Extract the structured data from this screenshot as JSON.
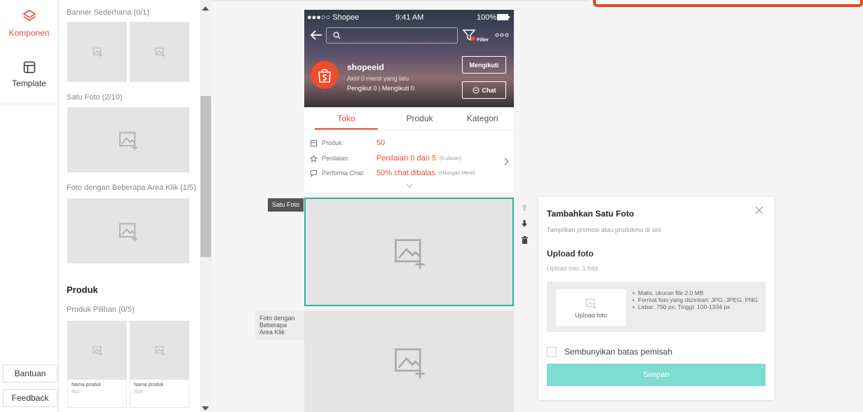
{
  "rail": {
    "items": [
      {
        "label": "Komponen"
      },
      {
        "label": "Template"
      }
    ],
    "help_label": "Bantuan",
    "feedback_label": "Feedback"
  },
  "panel": {
    "sections": {
      "banner": "Banner Sederhana (0/1)",
      "single_photo": "Satu Foto (2/10)",
      "multi_click": "Foto dengan Beberapa Area Klik (1/5)",
      "product_group": "Produk",
      "featured_products": "Produk Pilihan (0/5)"
    },
    "product_cards": [
      {
        "name": "Nama produk",
        "price": "Rp0"
      },
      {
        "name": "Nama produk",
        "price": "Rp0"
      }
    ]
  },
  "preview": {
    "status_bar": {
      "carrier": "●●●○○ Shopee",
      "time": "9:41 AM",
      "battery": "100%"
    },
    "filter_label": "Filter",
    "shop": {
      "name": "shopeeid",
      "status": "Aktif 0 menit yang lalu",
      "follow_stats": "Pengikut 0 | Mengikuti 0",
      "following_button": "Mengikuti",
      "chat_button": "Chat"
    },
    "tabs": [
      "Toko",
      "Produk",
      "Kategori"
    ],
    "stats": [
      {
        "label": "Produk:",
        "value": "50",
        "note": ""
      },
      {
        "label": "Penilaian:",
        "value": "Penilaian 0 dari 5",
        "note": "(0 ulasan)"
      },
      {
        "label": "Performa Chat:",
        "value": "50% chat dibalas",
        "note": "(Hitungan Menit)"
      }
    ],
    "selected_component_label": "Satu Foto",
    "next_component_label": "Foto dengan Beberapa Area Klik"
  },
  "config": {
    "title": "Tambahkan Satu Foto",
    "subtitle": "Tampilkan promosi atau produkmu di sini",
    "upload_heading": "Upload foto",
    "upload_min": "Upload min. 1 foto",
    "upload_box_label": "Upload foto",
    "rules": [
      "Maks. ukuran file 2.0 MB",
      "Format foto yang diizinkan: JPG, JPEG, PNG",
      "Lebar: 750 px; Tinggi: 100-1334 px"
    ],
    "hide_divider_label": "Sembunyikan batas pemisah",
    "save_label": "Simpan"
  },
  "colors": {
    "brand": "#ee4d2d",
    "selection": "#2bb39b",
    "save_button": "#7fdcd0"
  }
}
